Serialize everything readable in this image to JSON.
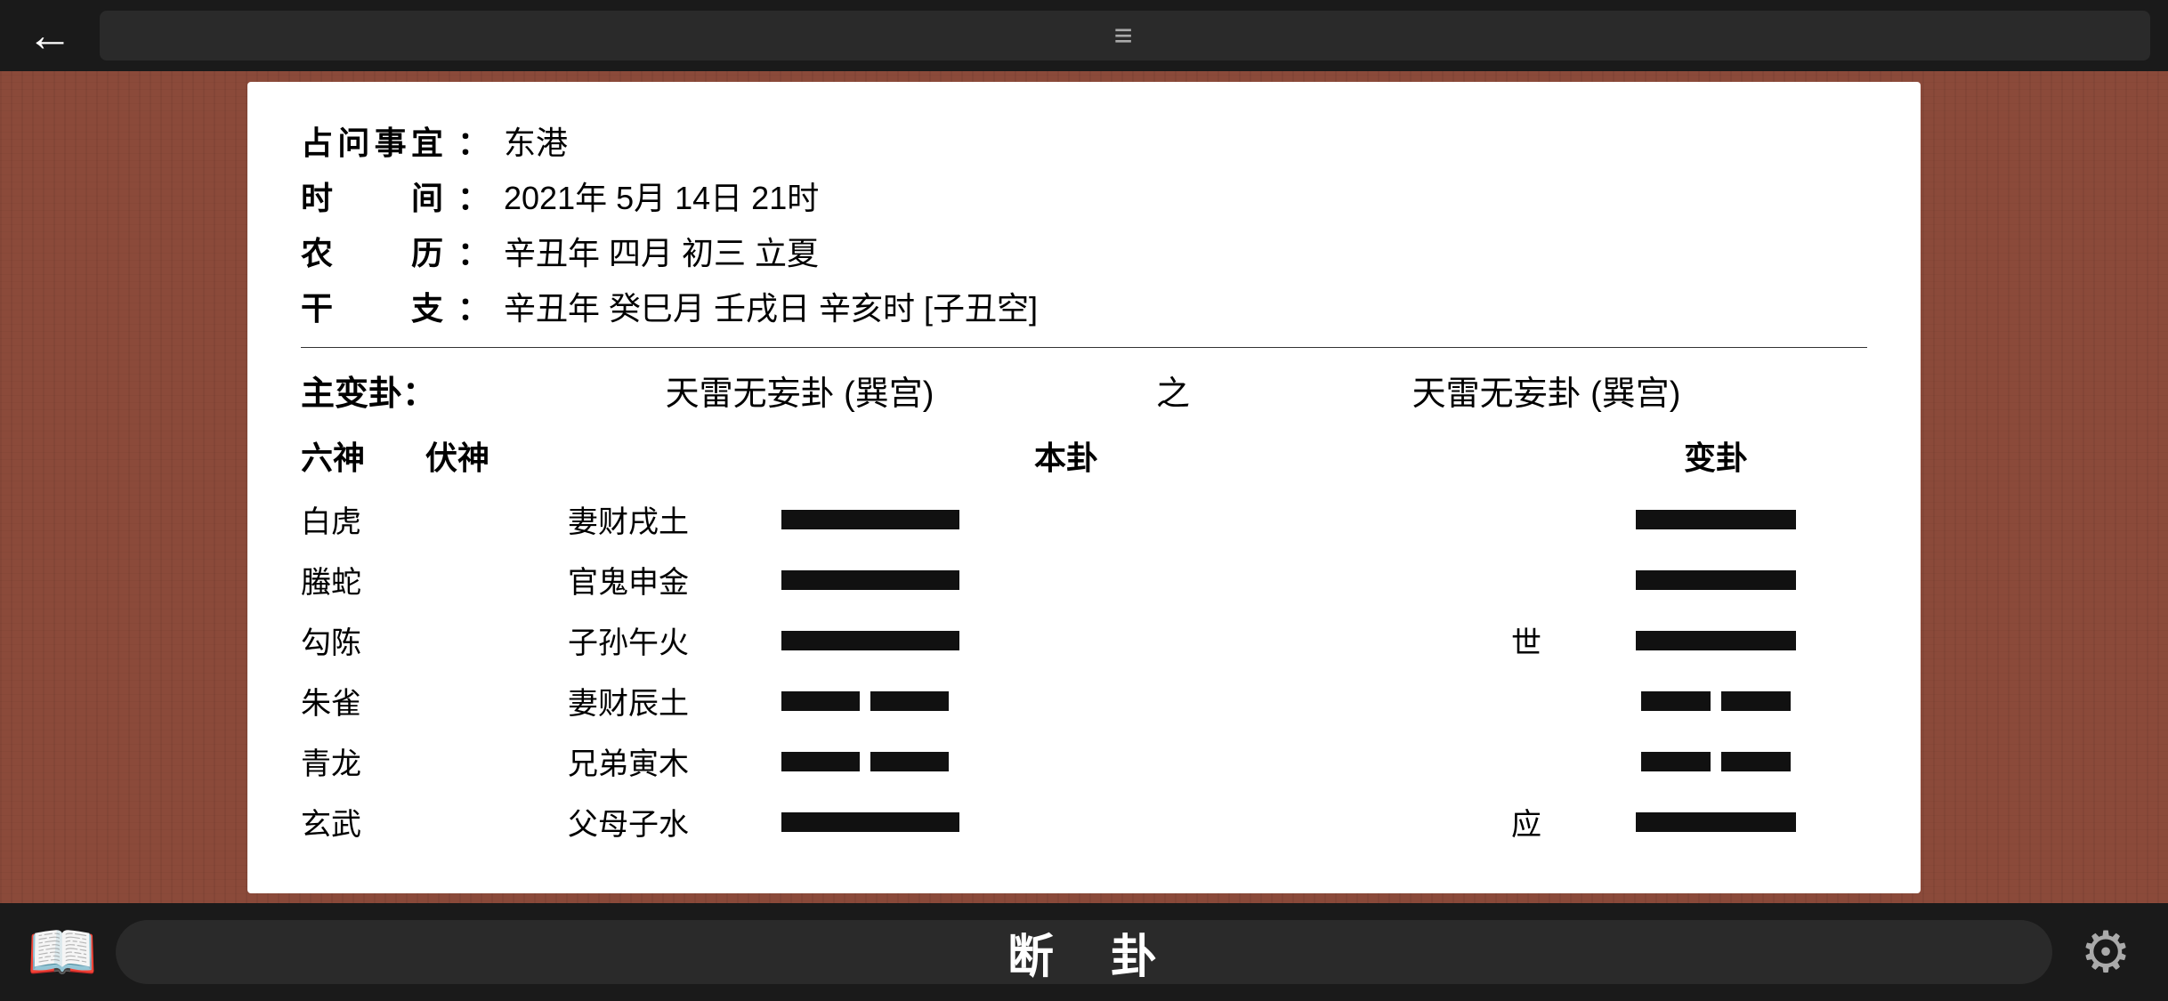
{
  "top_bar": {
    "back_label": "←",
    "hamburger": "≡"
  },
  "bottom_bar": {
    "book_icon": "📖",
    "label1": "断",
    "label2": "卦",
    "gear_icon": "⚙"
  },
  "info": {
    "label1": "占问事宜",
    "colon": "：",
    "value1": "东港",
    "label2": "时　间",
    "value2": "2021年 5月 14日 21时",
    "label3": "农　历",
    "value3": "辛丑年 四月 初三 立夏",
    "label4": "干　支",
    "value4": "辛丑年 癸巳月 壬戌日 辛亥时 [子丑空]"
  },
  "hexagram": {
    "main_label": "主变卦：",
    "bengua_title": "天雷无妄卦 (巽宫)",
    "zhi": "之",
    "biangua_title": "天雷无妄卦 (巽宫)",
    "col_liushen": "六神",
    "col_fushen": "伏神",
    "col_bengua": "本卦",
    "col_biangua": "变卦",
    "rows": [
      {
        "liushen": "白虎",
        "fushen": "",
        "yao": "妻财戌土",
        "line_type": "yang",
        "marker": "",
        "bline_type": "yang"
      },
      {
        "liushen": "螣蛇",
        "fushen": "",
        "yao": "官鬼申金",
        "line_type": "yang",
        "marker": "",
        "bline_type": "yang"
      },
      {
        "liushen": "勾陈",
        "fushen": "",
        "yao": "子孙午火",
        "line_type": "yang",
        "marker": "世",
        "bline_type": "yang"
      },
      {
        "liushen": "朱雀",
        "fushen": "",
        "yao": "妻财辰土",
        "line_type": "yin",
        "marker": "",
        "bline_type": "yin"
      },
      {
        "liushen": "青龙",
        "fushen": "",
        "yao": "兄弟寅木",
        "line_type": "yin",
        "marker": "",
        "bline_type": "yin"
      },
      {
        "liushen": "玄武",
        "fushen": "",
        "yao": "父母子水",
        "line_type": "yang",
        "marker": "应",
        "bline_type": "yang"
      }
    ]
  }
}
